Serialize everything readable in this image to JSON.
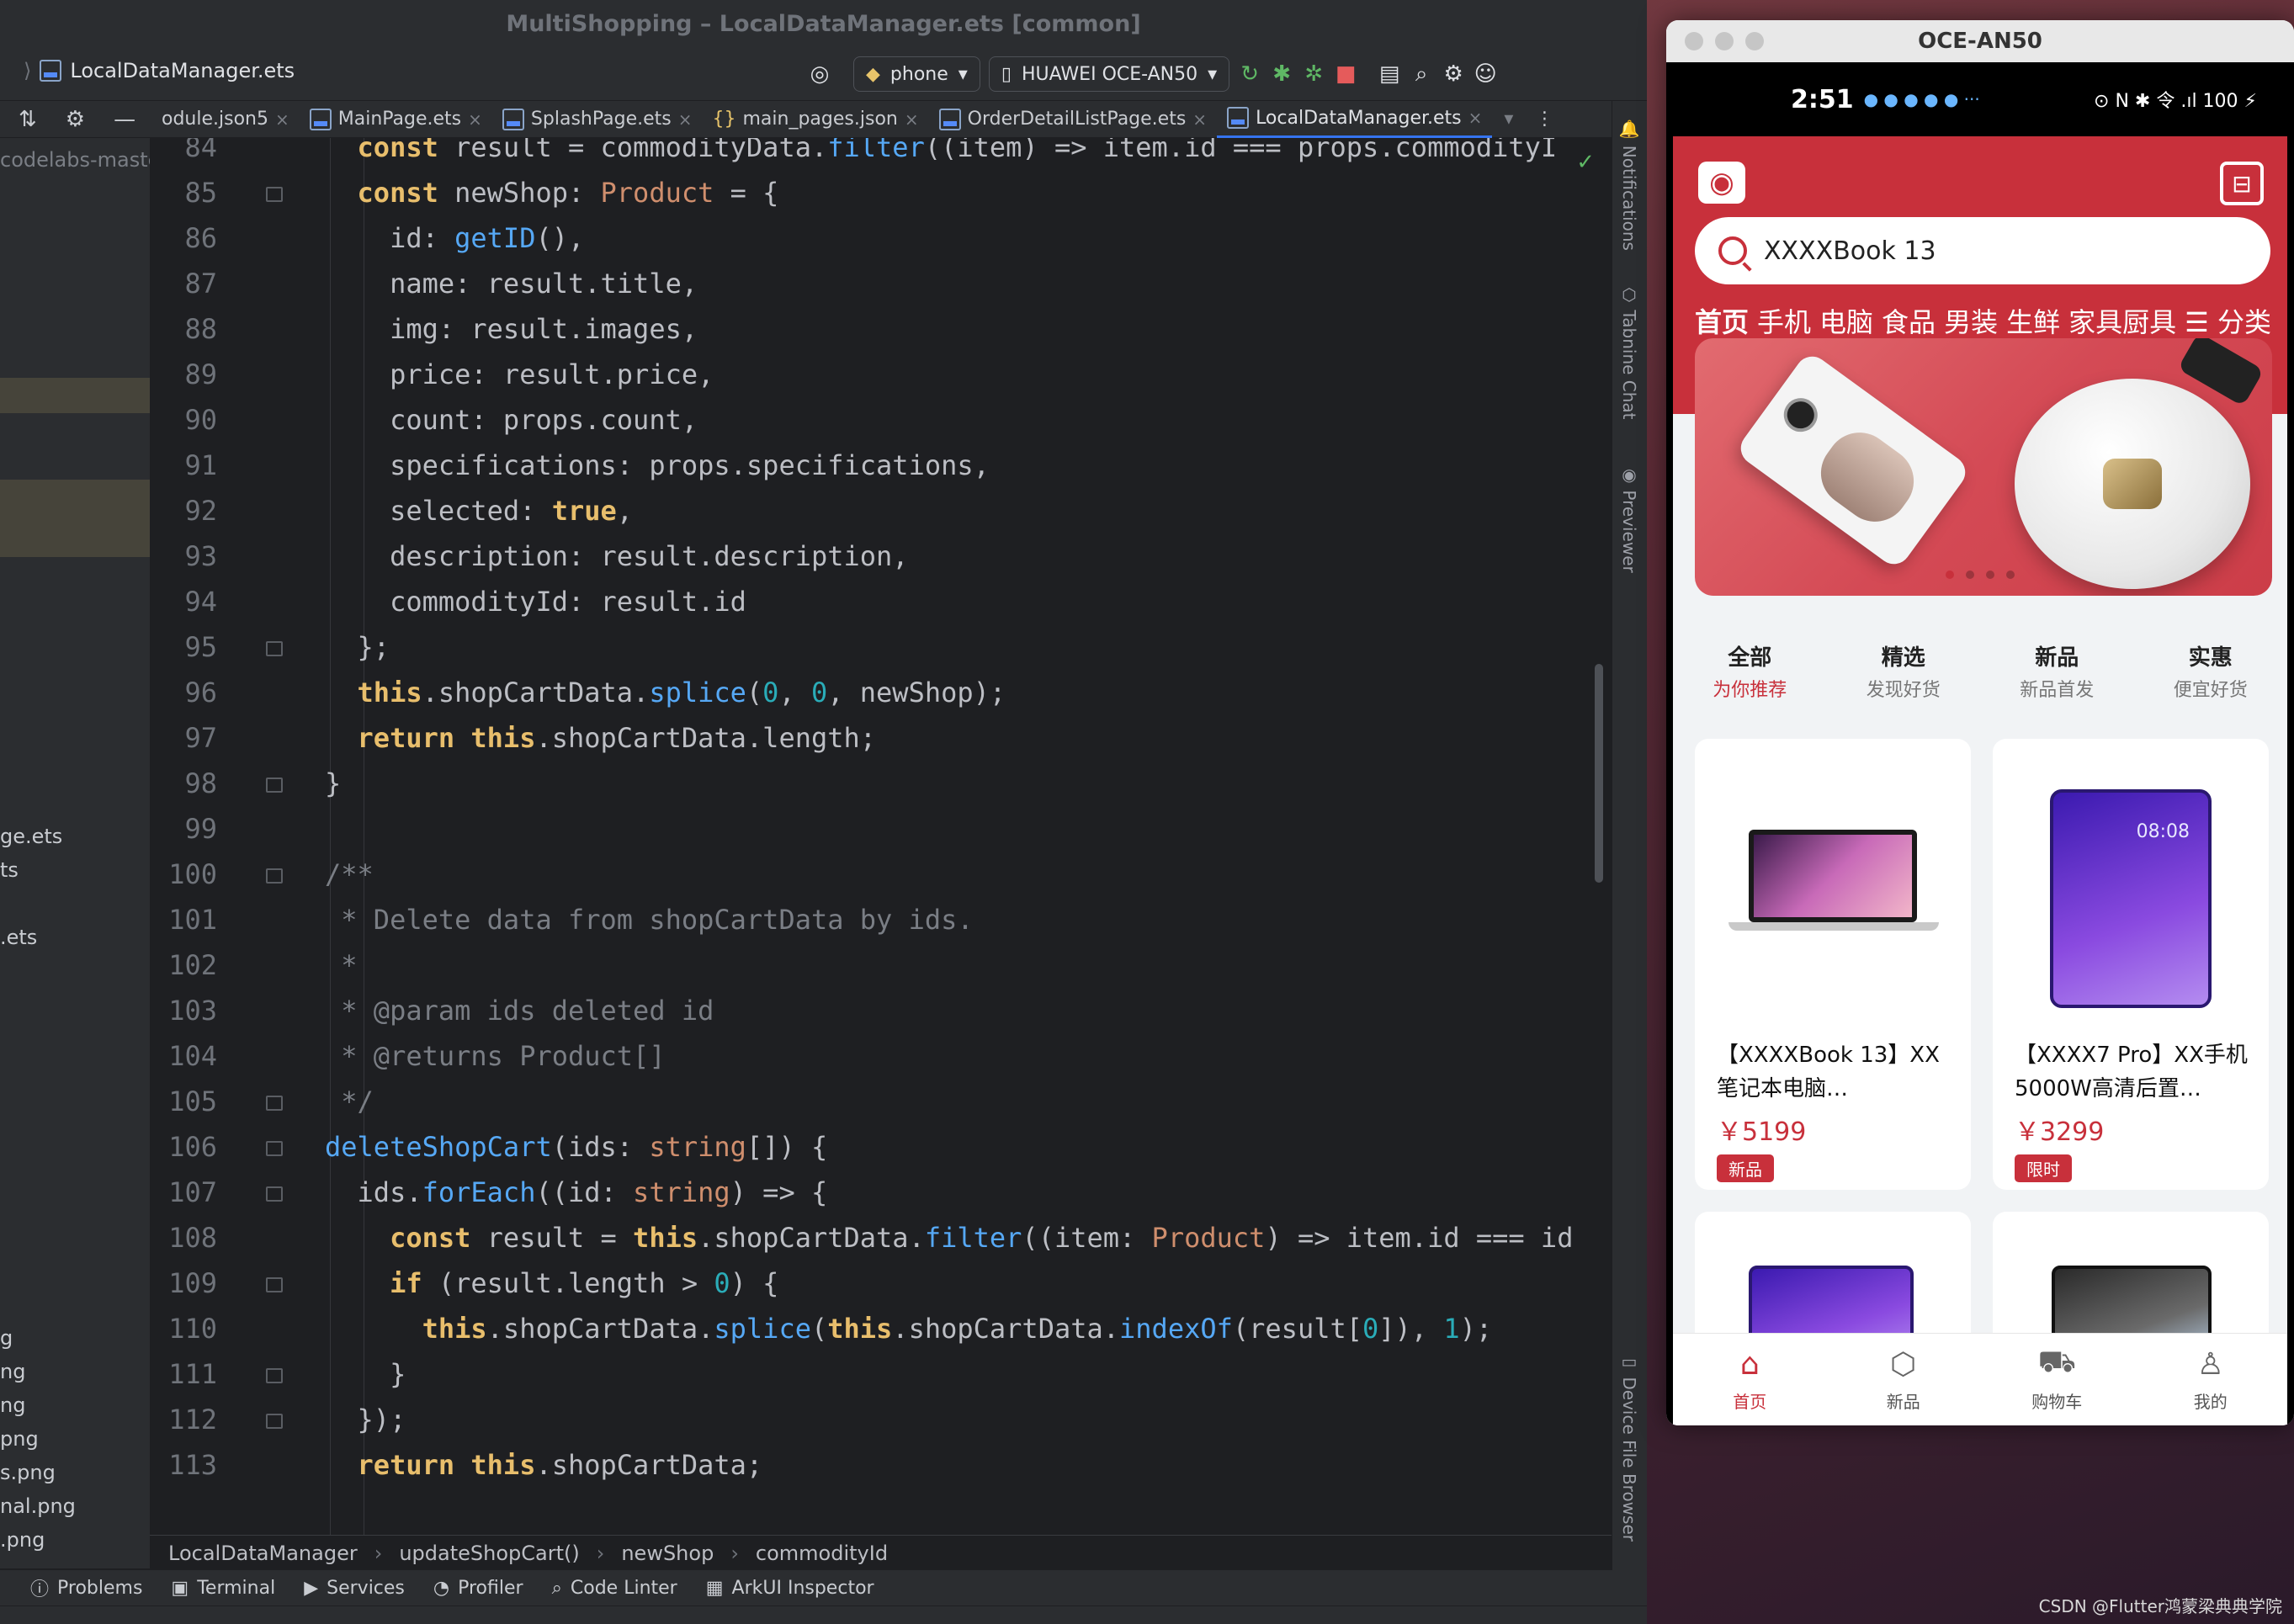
{
  "ide": {
    "window_title": "MultiShopping – LocalDataManager.ets [common]",
    "file_crumb": "LocalDataManager.ets",
    "run_config": "phone",
    "device": "HUAWEI OCE-AN50",
    "tabs": [
      {
        "label": "odule.json5",
        "active": false
      },
      {
        "label": "MainPage.ets",
        "active": false
      },
      {
        "label": "SplashPage.ets",
        "active": false
      },
      {
        "label": "main_pages.json",
        "active": false
      },
      {
        "label": "OrderDetailListPage.ets",
        "active": false
      },
      {
        "label": "LocalDataManager.ets",
        "active": true
      }
    ],
    "project_items": [
      "codelabs-maste",
      "ge.ets",
      "ts",
      ".ets",
      "g",
      "ng",
      "ng",
      "png",
      "s.png",
      "nal.png",
      ".png"
    ],
    "breadcrumb": [
      "LocalDataManager",
      "updateShopCart()",
      "newShop",
      "commodityId"
    ],
    "tool_windows": [
      "Problems",
      "Terminal",
      "Services",
      "Profiler",
      "Code Linter",
      "ArkUI Inspector"
    ],
    "right_tools": [
      "Notifications",
      "Tabnine Chat",
      "Previewer",
      "Device File Browser"
    ]
  },
  "emulator": {
    "title": "OCE-AN50",
    "status_time": "2:51",
    "status_icons": "⊙ N ✱ 令 .ıl 100 ⚡",
    "search_text": "XXXXBook 13",
    "categories": [
      "首页",
      "手机",
      "电脑",
      "食品",
      "男装",
      "生鲜",
      "家具厨具",
      "☰ 分类"
    ],
    "tabs": [
      {
        "title": "全部",
        "sub": "为你推荐"
      },
      {
        "title": "精选",
        "sub": "发现好货"
      },
      {
        "title": "新品",
        "sub": "新品首发"
      },
      {
        "title": "实惠",
        "sub": "便宜好货"
      }
    ],
    "products": [
      {
        "name": "【XXXXBook 13】XX笔记本电脑…",
        "price": "￥5199",
        "tag": "新品"
      },
      {
        "name": "【XXXX7 Pro】XX手机 5000W高清后置…",
        "price": "￥3299",
        "tag": "限时"
      }
    ],
    "phone_clock": "08:08",
    "nav": [
      "首页",
      "新品",
      "购物车",
      "我的"
    ]
  },
  "watermark": "CSDN @Flutter鸿蒙梁典典学院"
}
